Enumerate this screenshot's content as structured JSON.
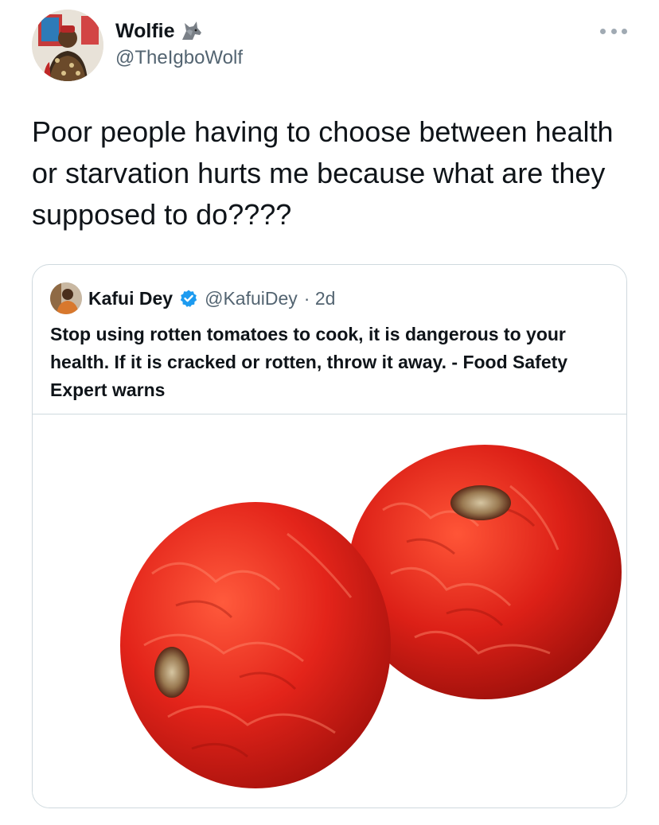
{
  "tweet": {
    "author": {
      "name": "Wolfie",
      "handle": "@TheIgboWolf",
      "avatar_icon": "profile-photo",
      "name_emoji": "wolf-icon"
    },
    "more_icon": "more-horizontal-icon",
    "text": "Poor people having to choose between health or starvation hurts me because what are they supposed to do????"
  },
  "quoted": {
    "author": {
      "name": "Kafui Dey",
      "handle": "@KafuiDey",
      "verified": true,
      "avatar_icon": "profile-photo"
    },
    "time": "· 2d",
    "text": "Stop using rotten tomatoes to cook, it is dangerous to your health. If it is cracked or rotten, throw it away. - Food Safety Expert warns",
    "media": "two rotten red tomatoes photo"
  },
  "colors": {
    "text_primary": "#0f1419",
    "text_secondary": "#536471",
    "border": "#cfd9de",
    "verified": "#1d9bf0",
    "tomato": "#e0231a"
  }
}
